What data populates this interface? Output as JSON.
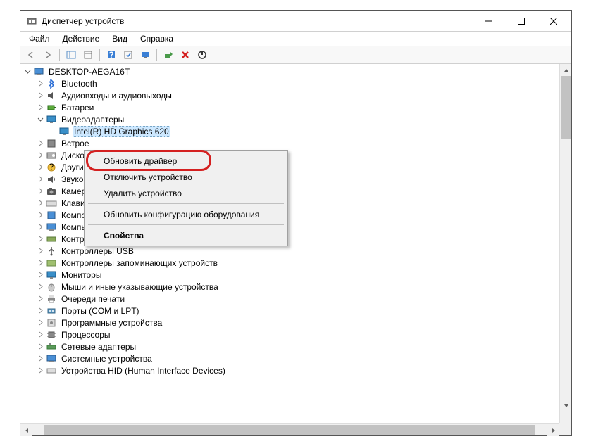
{
  "title": "Диспетчер устройств",
  "menu": {
    "file": "Файл",
    "action": "Действие",
    "view": "Вид",
    "help": "Справка"
  },
  "root": "DESKTOP-AEGA16T",
  "nodes": [
    {
      "label": "Bluetooth",
      "icon": "bluetooth"
    },
    {
      "label": "Аудиовходы и аудиовыходы",
      "icon": "audio"
    },
    {
      "label": "Батареи",
      "icon": "battery"
    },
    {
      "label": "Видеоадаптеры",
      "icon": "display",
      "expanded": true,
      "children": [
        {
          "label": "Intel(R) HD Graphics 620",
          "icon": "display",
          "selected": true
        }
      ]
    },
    {
      "label": "Встрое",
      "icon": "firmware",
      "cut": true
    },
    {
      "label": "Дисков",
      "icon": "disk",
      "cut": true
    },
    {
      "label": "Другие",
      "icon": "other",
      "cut": true
    },
    {
      "label": "Звуков",
      "icon": "sound",
      "cut": true
    },
    {
      "label": "Камер",
      "icon": "camera",
      "cut": true
    },
    {
      "label": "Клавиа",
      "icon": "keyboard",
      "cut": true
    },
    {
      "label": "Компо",
      "icon": "swcomp",
      "cut": true
    },
    {
      "label": "Компьютер",
      "icon": "computer"
    },
    {
      "label": "Контроллеры IDE ATA/ATAPI",
      "icon": "ide"
    },
    {
      "label": "Контроллеры USB",
      "icon": "usb"
    },
    {
      "label": "Контроллеры запоминающих устройств",
      "icon": "storage"
    },
    {
      "label": "Мониторы",
      "icon": "monitor"
    },
    {
      "label": "Мыши и иные указывающие устройства",
      "icon": "mouse"
    },
    {
      "label": "Очереди печати",
      "icon": "printer"
    },
    {
      "label": "Порты (COM и LPT)",
      "icon": "port"
    },
    {
      "label": "Программные устройства",
      "icon": "software"
    },
    {
      "label": "Процессоры",
      "icon": "cpu"
    },
    {
      "label": "Сетевые адаптеры",
      "icon": "network"
    },
    {
      "label": "Системные устройства",
      "icon": "system"
    },
    {
      "label": "Устройства HID (Human Interface Devices)",
      "icon": "hid"
    }
  ],
  "ctx": {
    "update": "Обновить драйвер",
    "disable": "Отключить устройство",
    "uninstall": "Удалить устройство",
    "scan": "Обновить конфигурацию оборудования",
    "props": "Свойства"
  }
}
